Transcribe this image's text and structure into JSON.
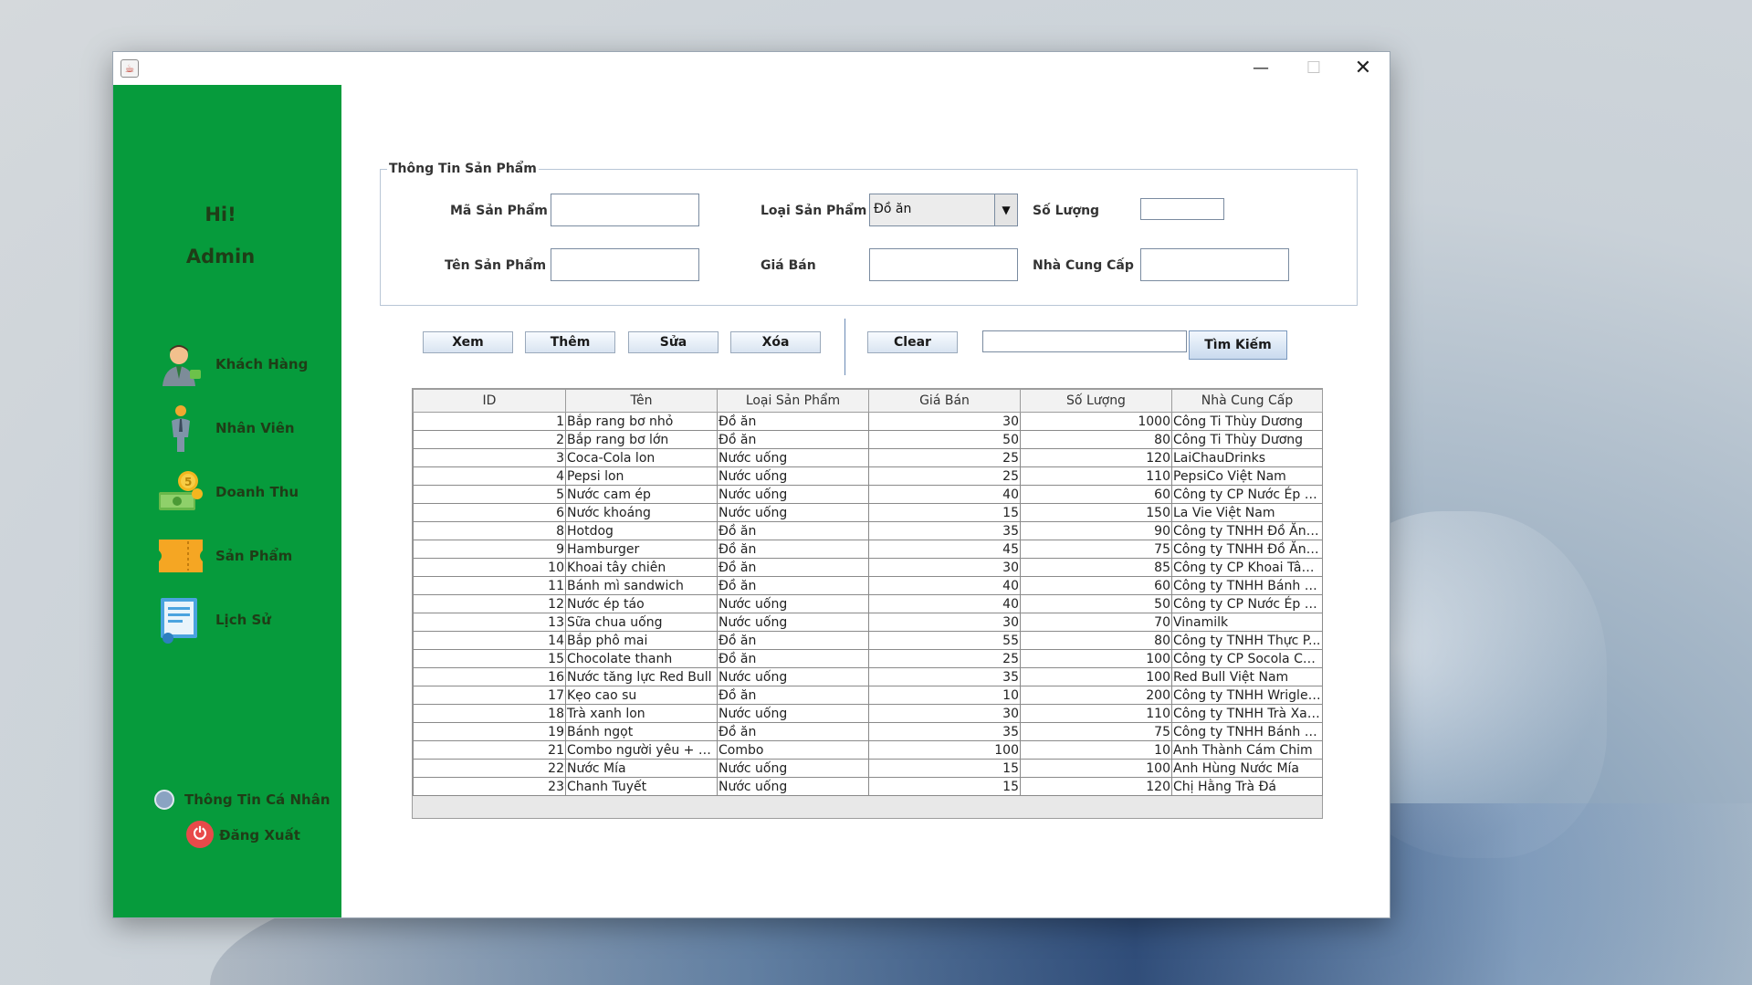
{
  "sidebar": {
    "greeting": "Hi!",
    "user": "Admin",
    "items": [
      {
        "label": "Khách Hàng",
        "icon": "customer-icon"
      },
      {
        "label": "Nhân Viên",
        "icon": "employee-icon"
      },
      {
        "label": "Doanh Thu",
        "icon": "revenue-icon"
      },
      {
        "label": "Sản Phẩm",
        "icon": "product-icon"
      },
      {
        "label": "Lịch Sử",
        "icon": "history-icon"
      }
    ],
    "profile_label": "Thông Tin Cá Nhân",
    "logout_label": "Đăng Xuất",
    "color": "#069b3c"
  },
  "form": {
    "legend": "Thông Tin Sản Phẩm",
    "ma_label": "Mã Sản Phẩm",
    "ten_label": "Tên Sản Phẩm",
    "loai_label": "Loại Sản Phẩm",
    "loai_value": "Đồ ăn",
    "gia_label": "Giá Bán",
    "soluong_label": "Số Lượng",
    "ncc_label": "Nhà Cung Cấp"
  },
  "toolbar": {
    "xem": "Xem",
    "them": "Thêm",
    "sua": "Sửa",
    "xoa": "Xóa",
    "clear": "Clear",
    "search_button": "Tìm Kiếm",
    "search_value": ""
  },
  "table": {
    "headers": [
      "ID",
      "Tên",
      "Loại Sản Phẩm",
      "Giá Bán",
      "Số Lượng",
      "Nhà Cung Cấp"
    ],
    "rows": [
      [
        "1",
        "Bắp rang bơ nhỏ",
        "Đồ ăn",
        "30",
        "1000",
        "Công Ti Thùy Dương"
      ],
      [
        "2",
        "Bắp rang bơ lớn",
        "Đồ ăn",
        "50",
        "80",
        "Công Ti Thùy Dương"
      ],
      [
        "3",
        "Coca-Cola lon",
        "Nước uống",
        "25",
        "120",
        "LaiChauDrinks"
      ],
      [
        "4",
        "Pepsi lon",
        "Nước uống",
        "25",
        "110",
        "PepsiCo Việt Nam"
      ],
      [
        "5",
        "Nước cam ép",
        "Nước uống",
        "40",
        "60",
        "Công ty CP Nước Ép T..."
      ],
      [
        "6",
        "Nước khoáng",
        "Nước uống",
        "15",
        "150",
        "La Vie Việt Nam"
      ],
      [
        "8",
        "Hotdog",
        "Đồ ăn",
        "35",
        "90",
        "Công ty TNHH Đồ Ăn N..."
      ],
      [
        "9",
        "Hamburger",
        "Đồ ăn",
        "45",
        "75",
        "Công ty TNHH Đồ Ăn N..."
      ],
      [
        "10",
        "Khoai tây chiên",
        "Đồ ăn",
        "30",
        "85",
        "Công ty CP Khoai Tây ..."
      ],
      [
        "11",
        "Bánh mì sandwich",
        "Đồ ăn",
        "40",
        "60",
        "Công ty TNHH Bánh Mì ..."
      ],
      [
        "12",
        "Nước ép táo",
        "Nước uống",
        "40",
        "50",
        "Công ty CP Nước Ép T..."
      ],
      [
        "13",
        "Sữa chua uống",
        "Nước uống",
        "30",
        "70",
        "Vinamilk"
      ],
      [
        "14",
        "Bắp phô mai",
        "Đồ ăn",
        "55",
        "80",
        "Công ty TNHH Thực P..."
      ],
      [
        "15",
        "Chocolate thanh",
        "Đồ ăn",
        "25",
        "100",
        "Công ty CP Socola Ch..."
      ],
      [
        "16",
        "Nước tăng lực Red Bull",
        "Nước uống",
        "35",
        "100",
        "Red Bull Việt Nam"
      ],
      [
        "17",
        "Kẹo cao su",
        "Đồ ăn",
        "10",
        "200",
        "Công ty TNHH Wrigley ..."
      ],
      [
        "18",
        "Trà xanh lon",
        "Nước uống",
        "30",
        "110",
        "Công ty TNHH Trà Xan..."
      ],
      [
        "19",
        "Bánh ngọt",
        "Đồ ăn",
        "35",
        "75",
        "Công ty TNHH Bánh Kẹ..."
      ],
      [
        "21",
        "Combo người yêu + hô...",
        "Combo",
        "100",
        "10",
        "Anh Thành Cám Chim"
      ],
      [
        "22",
        "Nước Mía",
        "Nước uống",
        "15",
        "100",
        "Anh Hùng Nước Mía"
      ],
      [
        "23",
        "Chanh Tuyết",
        "Nước uống",
        "15",
        "120",
        "Chị Hằng Trà Đá"
      ]
    ]
  }
}
